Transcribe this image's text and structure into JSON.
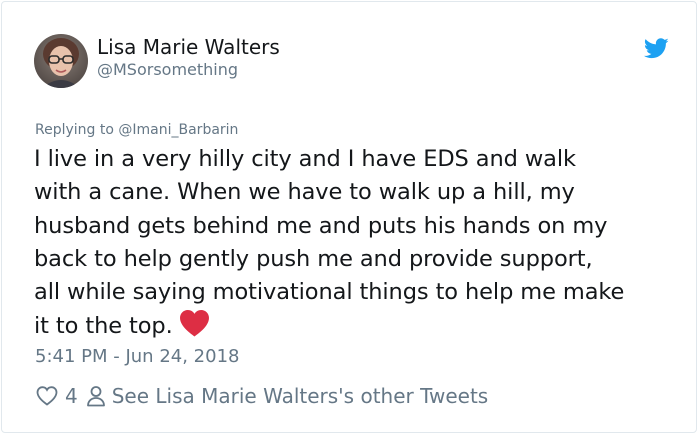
{
  "author": {
    "name": "Lisa Marie Walters",
    "handle": "@MSorsomething"
  },
  "reply": {
    "prefix": "Replying to ",
    "mention": "@Imani_Barbarin"
  },
  "tweet": {
    "lines": [
      "I live in a very hilly city and I have EDS and walk",
      "with a cane. When we have to walk up a hill, my",
      "husband gets behind me and puts his hands on my",
      "back to help gently push me and provide support,",
      "all while saying motivational things to help me make",
      "it to the top."
    ],
    "emoji": "red-heart"
  },
  "timestamp": "5:41 PM - Jun 24, 2018",
  "footer": {
    "like_count": "4",
    "other_tweets_link": "See Lisa Marie Walters's other Tweets"
  },
  "colors": {
    "text": "#14171a",
    "secondary": "#657786",
    "twitter_blue": "#1da1f2",
    "heart_red": "#dd2e44",
    "border": "#e1e8ed"
  },
  "icons": [
    "twitter-bird-icon",
    "heart-outline-icon",
    "person-icon",
    "red-heart-emoji"
  ]
}
